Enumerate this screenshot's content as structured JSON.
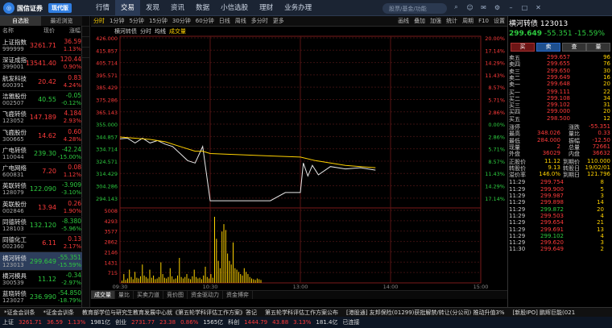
{
  "topbar": {
    "logo_text": "国信证券",
    "mode_button": "现代版",
    "search_placeholder": "股票/基金/功能",
    "menu": [
      "行情",
      "交易",
      "发现",
      "资讯",
      "数据",
      "小信选股",
      "理财",
      "业务办理"
    ],
    "active_menu": 1
  },
  "left": {
    "tabs": [
      "自选股",
      "最近浏览"
    ],
    "header": [
      "名称",
      "现价",
      "涨幅"
    ],
    "rows": [
      {
        "name": "上证指数",
        "code": "999999",
        "price": "3261.71",
        "chg": "36.59",
        "pct": "1.13%",
        "c": "red"
      },
      {
        "name": "深证成指",
        "code": "399001",
        "price": "13541.40",
        "chg": "120.44",
        "pct": "0.90%",
        "c": "red"
      },
      {
        "name": "航发科技",
        "code": "600391",
        "price": "20.42",
        "chg": "0.83",
        "pct": "4.24%",
        "c": "red"
      },
      {
        "name": "洁雅股份",
        "code": "002507",
        "price": "40.55",
        "chg": "-0.05",
        "pct": "-0.12%",
        "c": "green"
      },
      {
        "name": "飞鹿转债",
        "code": "123052",
        "price": "147.189",
        "chg": "4.184",
        "pct": "2.93%",
        "c": "red"
      },
      {
        "name": "飞鹿股份",
        "code": "300665",
        "price": "14.62",
        "chg": "0.60",
        "pct": "4.28%",
        "c": "red"
      },
      {
        "name": "广电转债",
        "code": "110044",
        "price": "239.30",
        "chg": "-42.24",
        "pct": "-15.00%",
        "c": "green"
      },
      {
        "name": "广电网络",
        "code": "600831",
        "price": "7.20",
        "chg": "0.08",
        "pct": "1.12%",
        "c": "red"
      },
      {
        "name": "英联转债",
        "code": "128079",
        "price": "122.090",
        "chg": "-3.909",
        "pct": "-3.10%",
        "c": "green"
      },
      {
        "name": "英联股份",
        "code": "002846",
        "price": "13.94",
        "chg": "0.26",
        "pct": "1.90%",
        "c": "red"
      },
      {
        "name": "同德转债",
        "code": "128103",
        "price": "132.120",
        "chg": "-8.380",
        "pct": "-5.96%",
        "c": "green"
      },
      {
        "name": "同德化工",
        "code": "002360",
        "price": "6.11",
        "chg": "0.13",
        "pct": "2.17%",
        "c": "red"
      },
      {
        "name": "横河转债",
        "code": "123013",
        "price": "299.649",
        "chg": "-55.351",
        "pct": "-15.59%",
        "c": "green"
      },
      {
        "name": "横河模具",
        "code": "300539",
        "price": "11.12",
        "chg": "-0.34",
        "pct": "-2.97%",
        "c": "green"
      },
      {
        "name": "蓝晓转债",
        "code": "123027",
        "price": "236.990",
        "chg": "-54.850",
        "pct": "-18.79%",
        "c": "green"
      }
    ]
  },
  "chart_toolbar": {
    "left": [
      "分时",
      "1分钟",
      "5分钟",
      "15分钟",
      "30分钟",
      "60分钟",
      "日线",
      "周线",
      "多分时",
      "更多"
    ],
    "right": [
      "画线",
      "叠加",
      "加强",
      "统计",
      "周期",
      "F10",
      "设置"
    ]
  },
  "chart_info": {
    "name": "横河转债",
    "mode": "分时",
    "avg_label": "均线",
    "vol_label": "成交量"
  },
  "chart_data": {
    "type": "line",
    "price_axis": [
      "426.000",
      "415.857",
      "405.714",
      "395.571",
      "385.429",
      "375.286",
      "365.143",
      "355.000",
      "344.857",
      "334.714",
      "324.571",
      "314.429",
      "304.286",
      "294.143"
    ],
    "pct_axis": [
      "20.00%",
      "17.14%",
      "14.29%",
      "11.43%",
      "8.57%",
      "5.71%",
      "2.86%",
      "0.00%",
      "2.86%",
      "5.71%",
      "8.57%",
      "11.43%",
      "14.29%",
      "17.14%"
    ],
    "vol_axis": [
      "5008",
      "4293",
      "3577",
      "2862",
      "2146",
      "1431",
      "715"
    ],
    "time_axis": [
      "09:30",
      "10:30",
      "13:00",
      "14:00",
      "15:00"
    ],
    "ylim": [
      284,
      426
    ],
    "series": [
      {
        "values": [
          [
            0,
            340.5
          ],
          [
            5,
            341
          ],
          [
            10,
            337
          ],
          [
            15,
            341
          ],
          [
            20,
            337
          ],
          [
            25,
            339
          ],
          [
            30,
            336
          ],
          [
            35,
            334
          ],
          [
            40,
            328
          ],
          [
            45,
            322
          ],
          [
            50,
            320
          ],
          [
            55,
            334
          ],
          [
            60,
            288
          ],
          [
            70,
            288
          ],
          [
            80,
            288
          ],
          [
            90,
            288
          ],
          [
            100,
            288
          ],
          [
            110,
            295
          ],
          [
            120,
            295
          ],
          [
            122,
            320
          ],
          [
            125,
            309
          ],
          [
            128,
            318
          ],
          [
            132,
            310
          ],
          [
            140,
            317
          ],
          [
            150,
            315
          ],
          [
            160,
            316
          ],
          [
            170,
            314
          ]
        ]
      },
      {
        "values": [
          [
            0,
            342
          ],
          [
            10,
            341
          ],
          [
            20,
            340
          ],
          [
            30,
            338
          ],
          [
            40,
            334
          ],
          [
            50,
            330
          ],
          [
            55,
            330
          ],
          [
            60,
            328
          ],
          [
            80,
            327
          ],
          [
            100,
            326
          ],
          [
            120,
            325
          ],
          [
            130,
            322
          ],
          [
            140,
            320
          ],
          [
            150,
            318
          ],
          [
            160,
            317
          ],
          [
            170,
            316
          ]
        ]
      }
    ],
    "volume": [
      3,
      12,
      4,
      6,
      18,
      8,
      5,
      15,
      7,
      6,
      9,
      25,
      10,
      8,
      6,
      18,
      7,
      10,
      5,
      6,
      8,
      28,
      12,
      7,
      6,
      8,
      20,
      9,
      5,
      6,
      10,
      34,
      8,
      6,
      8,
      12,
      6,
      5,
      9,
      18,
      8,
      6,
      7,
      5,
      10,
      22,
      8,
      6,
      12,
      7,
      90,
      60,
      30,
      20,
      70,
      80,
      72,
      40,
      30,
      25,
      55,
      20,
      18,
      15,
      12,
      10,
      20,
      15,
      12,
      8,
      6,
      5,
      4,
      6,
      5,
      4
    ],
    "xlim": [
      0,
      240
    ]
  },
  "bottom_tabs": [
    "成交量",
    "量比",
    "买卖力道",
    "竞价图",
    "资金驱动力",
    "资金博弈"
  ],
  "right": {
    "title": "横河转债",
    "code": "123013",
    "price": "299.649",
    "chg": "-55.351",
    "pct": "-15.59%",
    "buttons": [
      "买",
      "卖",
      "查",
      "量"
    ],
    "asks": [
      {
        "l": "卖五",
        "v": "299.657",
        "s": "96"
      },
      {
        "l": "卖四",
        "v": "299.655",
        "s": "76"
      },
      {
        "l": "卖三",
        "v": "299.650",
        "s": "30"
      },
      {
        "l": "卖二",
        "v": "299.649",
        "s": "16"
      },
      {
        "l": "卖一",
        "v": "299.648",
        "s": "20"
      }
    ],
    "bids": [
      {
        "l": "买一",
        "v": "299.111",
        "s": "22"
      },
      {
        "l": "买二",
        "v": "299.108",
        "s": "34"
      },
      {
        "l": "买三",
        "v": "299.102",
        "s": "31"
      },
      {
        "l": "买四",
        "v": "299.000",
        "s": "20"
      },
      {
        "l": "买五",
        "v": "298.500",
        "s": "12"
      }
    ],
    "stats": [
      {
        "a": "涨停",
        "b": "",
        "c": "涨跌",
        "d": "-55.351"
      },
      {
        "a": "最高",
        "b": "348.026",
        "c": "量比",
        "d": "0.33"
      },
      {
        "a": "最低",
        "b": "284.000",
        "c": "振幅",
        "d": "-12.50"
      },
      {
        "a": "现量",
        "b": "2",
        "c": "总量",
        "d": "72661"
      },
      {
        "a": "外盘",
        "b": "36029",
        "c": "内盘",
        "d": "36632"
      }
    ],
    "conv": [
      {
        "a": "正股价",
        "b": "11.12",
        "c": "到期价",
        "d": "110.000"
      },
      {
        "a": "转股价",
        "b": "9.13",
        "c": "转股日",
        "d": "19/02/01"
      },
      {
        "a": "溢价率",
        "b": "146.0%",
        "c": "到期日",
        "d": "121.796"
      }
    ],
    "ticks": [
      {
        "t": "11:29",
        "p": "299.754",
        "v": "8",
        "c": "red"
      },
      {
        "t": "11:29",
        "p": "299.900",
        "v": "5",
        "c": "red"
      },
      {
        "t": "11:29",
        "p": "299.987",
        "v": "3",
        "c": "red"
      },
      {
        "t": "11:29",
        "p": "299.898",
        "v": "14",
        "c": "red"
      },
      {
        "t": "11:29",
        "p": "299.872",
        "v": "20",
        "c": "green"
      },
      {
        "t": "11:29",
        "p": "299.503",
        "v": "4",
        "c": "red"
      },
      {
        "t": "11:29",
        "p": "299.654",
        "v": "21",
        "c": "red"
      },
      {
        "t": "11:29",
        "p": "299.691",
        "v": "13",
        "c": "red"
      },
      {
        "t": "11:29",
        "p": "299.102",
        "v": "4",
        "c": "green"
      },
      {
        "t": "11:29",
        "p": "299.620",
        "v": "3",
        "c": "red"
      },
      {
        "t": "11:30",
        "p": "299.649",
        "v": "2",
        "c": "red"
      }
    ]
  },
  "ticker": [
    "*证金会训条",
    "*证金会训条",
    "教育部学位与研究生教育发展中心就《第五轮学科评估工作方案》答记",
    "第五轮学科评估工作方案公布",
    "[港股通] 友邦保险(01299)获批解禁/转让(分公司) 推动升值3%",
    "[新股IPO] 鹏辉巨能(021"
  ],
  "status": [
    "上证",
    "3261.71",
    "36.59",
    "1.13%",
    "1981亿",
    "创业",
    "2731.77",
    "23.38",
    "0.86%",
    "1565亿",
    "科创",
    "1444.79",
    "43.88",
    "3.13%",
    "181.4亿",
    "已连接"
  ]
}
